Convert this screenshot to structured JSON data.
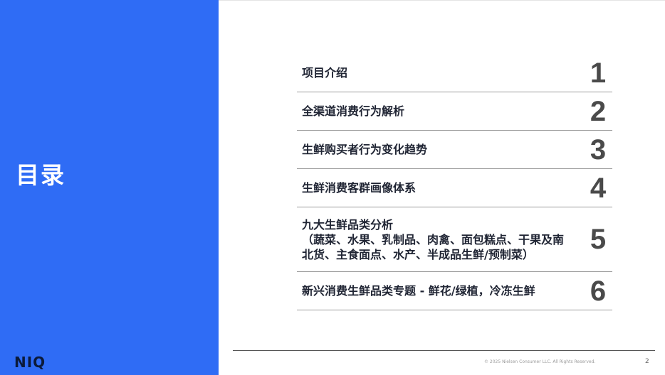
{
  "slide": {
    "title": "目录",
    "logo": "NIQ",
    "copyright": "© 2025 Nielsen Consumer LLC. All Rights Reserved.",
    "page_number": "2"
  },
  "toc": {
    "items": [
      {
        "label": "项目介绍",
        "number": "1"
      },
      {
        "label": "全渠道消费行为解析",
        "number": "2"
      },
      {
        "label": "生鲜购买者行为变化趋势",
        "number": "3"
      },
      {
        "label": "生鲜消费客群画像体系",
        "number": "4"
      },
      {
        "label": "九大生鲜品类分析\n（蔬菜、水果、乳制品、肉禽、面包糕点、干果及南北货、主食面点、水产、半成品生鲜/预制菜）",
        "number": "5"
      },
      {
        "label": "新兴消费生鲜品类专题 - 鲜花/绿植，冷冻生鲜",
        "number": "6"
      }
    ]
  }
}
